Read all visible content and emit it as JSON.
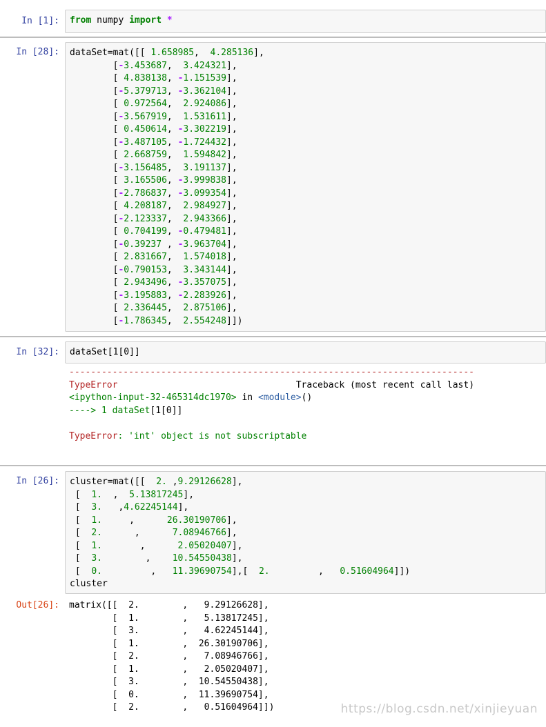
{
  "cells": [
    {
      "prompt": "In  [1]:",
      "code_html": "<span class=\"kw\">from</span> numpy <span class=\"kw\">import</span> <span class=\"op\">*</span>"
    },
    {
      "prompt": "In  [28]:",
      "lines": [
        "dataSet=mat([[ 1.658985,  4.285136],",
        "        [-3.453687,  3.424321],",
        "        [ 4.838138, -1.151539],",
        "        [-5.379713, -3.362104],",
        "        [ 0.972564,  2.924086],",
        "        [-3.567919,  1.531611],",
        "        [ 0.450614, -3.302219],",
        "        [-3.487105, -1.724432],",
        "        [ 2.668759,  1.594842],",
        "        [-3.156485,  3.191137],",
        "        [ 3.165506, -3.999838],",
        "        [-2.786837, -3.099354],",
        "        [ 4.208187,  2.984927],",
        "        [-2.123337,  2.943366],",
        "        [ 0.704199, -0.479481],",
        "        [-0.39237 , -3.963704],",
        "        [ 2.831667,  1.574018],",
        "        [-0.790153,  3.343144],",
        "        [ 2.943496, -3.357075],",
        "        [-3.195883, -2.283926],",
        "        [ 2.336445,  2.875106],",
        "        [-1.786345,  2.554248]])"
      ]
    },
    {
      "prompt": "In  [32]:",
      "code": "dataSet[1[0]]",
      "traceback": {
        "rule": "---------------------------------------------------------------------------",
        "error_name": "TypeError",
        "traceback_label": "Traceback (most recent call last)",
        "location_prefix": "<ipython-input-32-465314dc1970>",
        "location_in": " in ",
        "location_module": "<module>",
        "location_suffix": "()",
        "arrow_line": "----> 1 dataSet",
        "arrow_code": "[1[0]]",
        "final_name": "TypeError",
        "final_msg": ": 'int' object is not subscriptable"
      }
    },
    {
      "prompt": "In  [26]:",
      "lines": [
        "cluster=mat([[  2. ,9.29126628],",
        " [  1.  ,  5.13817245],",
        " [  3.   ,4.62245144],",
        " [  1.     ,      26.30190706],",
        " [  2.      ,      7.08946766],",
        " [  1.       ,      2.05020407],",
        " [  3.        ,    10.54550438],",
        " [  0.         ,   11.39690754],[  2.         ,   0.51604964]])",
        "cluster"
      ],
      "out_prompt": "Out[26]:",
      "out_lines": [
        "matrix([[  2.        ,   9.29126628],",
        "        [  1.        ,   5.13817245],",
        "        [  3.        ,   4.62245144],",
        "        [  1.        ,  26.30190706],",
        "        [  2.        ,   7.08946766],",
        "        [  1.        ,   2.05020407],",
        "        [  3.        ,  10.54550438],",
        "        [  0.        ,  11.39690754],",
        "        [  2.        ,   0.51604964]])"
      ]
    }
  ],
  "watermark": "https://blog.csdn.net/xinjieyuan"
}
